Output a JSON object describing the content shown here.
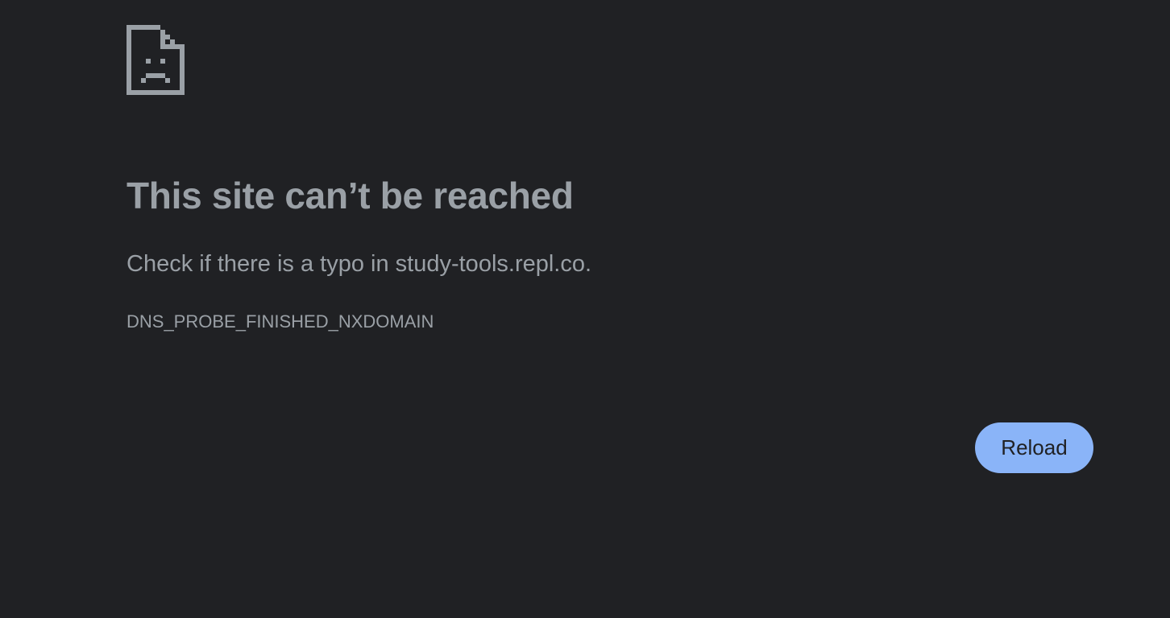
{
  "icon": {
    "name": "sad-page-icon",
    "color": "#9aa0a6"
  },
  "error": {
    "title": "This site can’t be reached",
    "message": "Check if there is a typo in study-tools.repl.co.",
    "code": "DNS_PROBE_FINISHED_NXDOMAIN"
  },
  "buttons": {
    "reload_label": "Reload"
  },
  "colors": {
    "background": "#202124",
    "text": "#9aa0a6",
    "button_bg": "#8ab4f8",
    "button_text": "#202124"
  }
}
